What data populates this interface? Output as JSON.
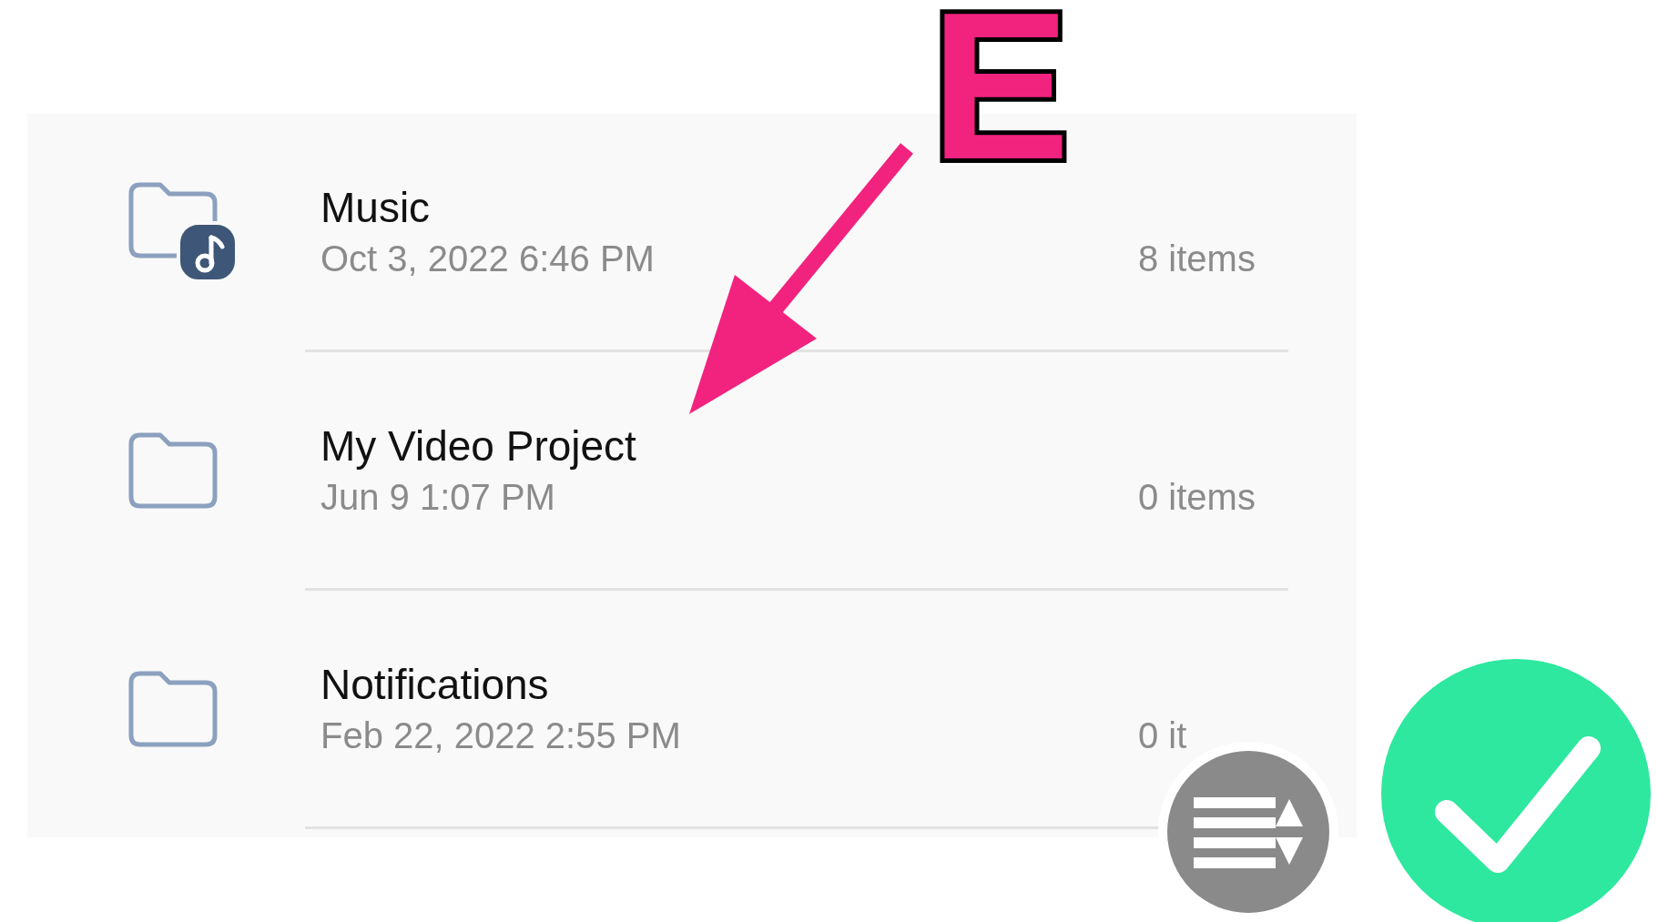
{
  "folders": [
    {
      "kind": "music-folder",
      "name": "Music",
      "date": "Oct 3, 2022 6:46 PM",
      "count": "8 items"
    },
    {
      "kind": "folder",
      "name": "My Video Project",
      "date": "Jun 9 1:07 PM",
      "count": "0 items"
    },
    {
      "kind": "folder",
      "name": "Notifications",
      "date": "Feb 22, 2022 2:55 PM",
      "count": "0 it"
    }
  ],
  "annotation": {
    "letter": "E"
  }
}
